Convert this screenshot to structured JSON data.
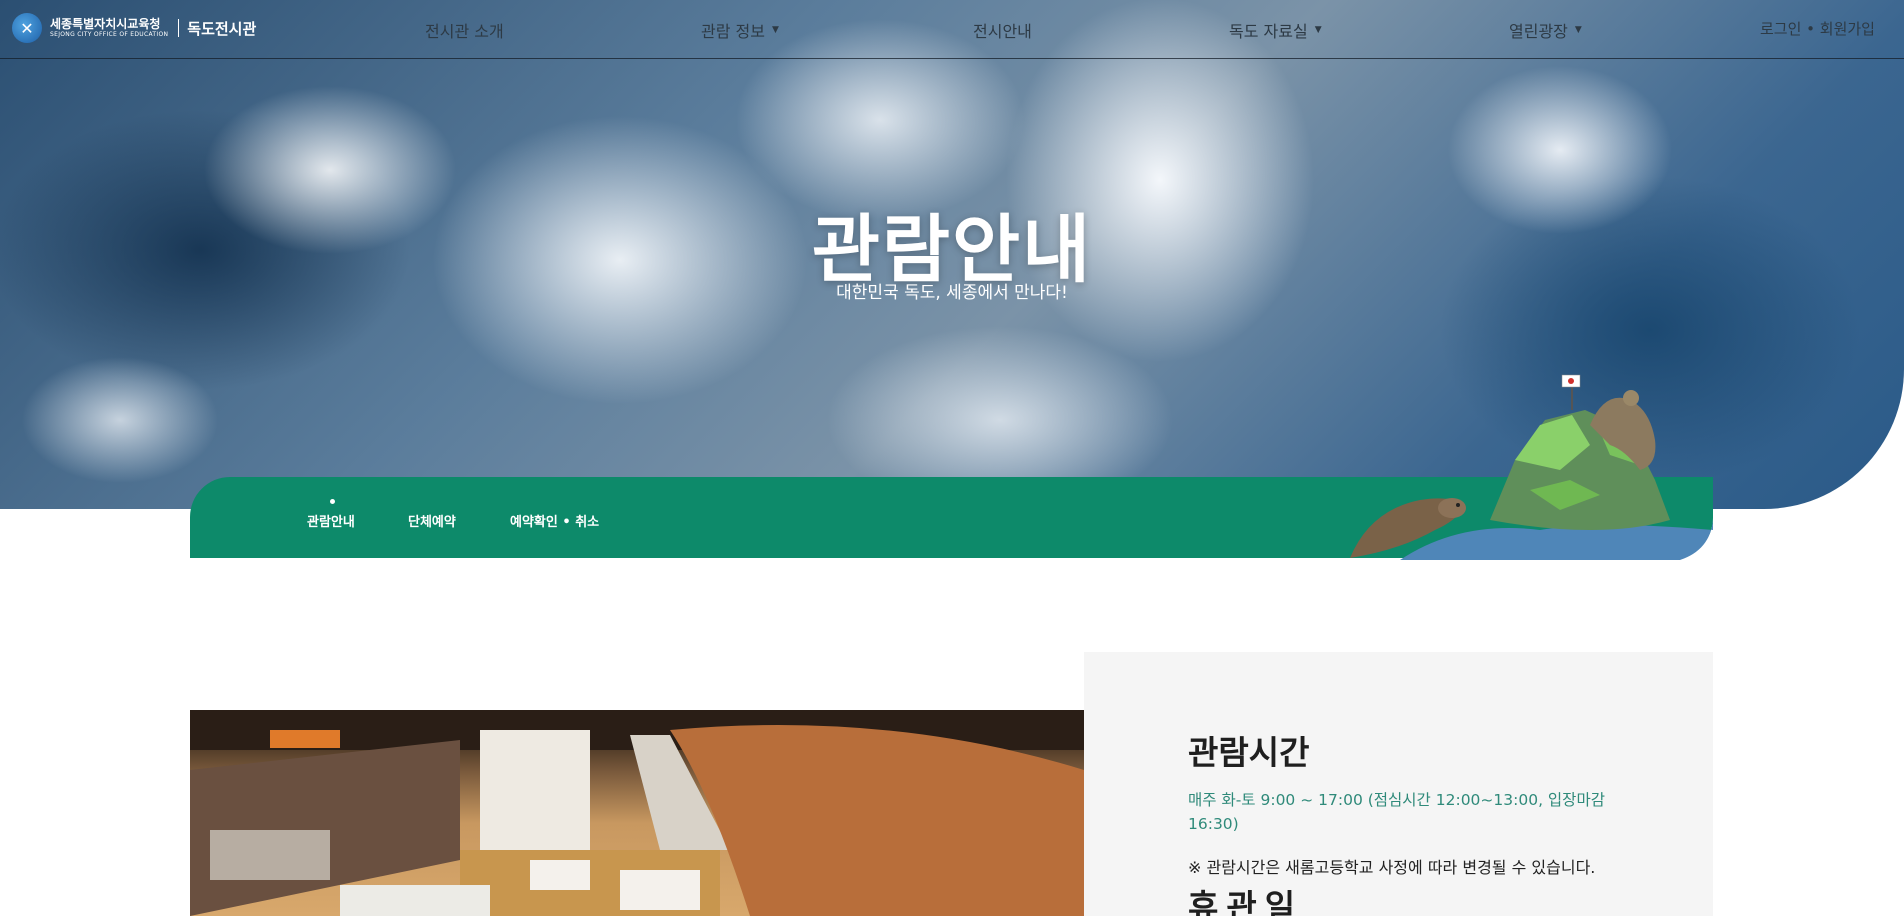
{
  "header": {
    "logo": {
      "org_name": "세종특별자치시교육청",
      "org_name_en": "SEJONG CITY OFFICE OF EDUCATION",
      "site_name": "독도전시관"
    },
    "nav": [
      {
        "label": "전시관 소개",
        "has_dropdown": false
      },
      {
        "label": "관람 정보",
        "has_dropdown": true
      },
      {
        "label": "전시안내",
        "has_dropdown": false
      },
      {
        "label": "독도 자료실",
        "has_dropdown": true
      },
      {
        "label": "열린광장",
        "has_dropdown": true
      }
    ],
    "auth": "로그인 • 회원가입"
  },
  "hero": {
    "title": "관람안내",
    "subtitle": "대한민국 독도, 세종에서 만나다!"
  },
  "subnav": {
    "items": [
      {
        "label": "관람안내",
        "active": true
      },
      {
        "label": "단체예약",
        "active": false
      },
      {
        "label": "예약확인 • 취소",
        "active": false
      }
    ],
    "color": "#0d8a6a"
  },
  "info": {
    "hours_title": "관람시간",
    "hours_text": "매주 화-토 9:00 ~ 17:00 (점심시간 12:00~13:00, 입장마감 16:30)",
    "hours_note": "※ 관람시간은 새롬고등학교 사정에 따라 변경될 수 있습니다.",
    "closed_title": "휴관일",
    "accent_color": "#2f8a7a"
  },
  "icons": {
    "logo": "sejong-education-logo-icon",
    "dropdown": "caret-down-icon",
    "illustration": "dokdo-island-sea-lion-illustration"
  }
}
